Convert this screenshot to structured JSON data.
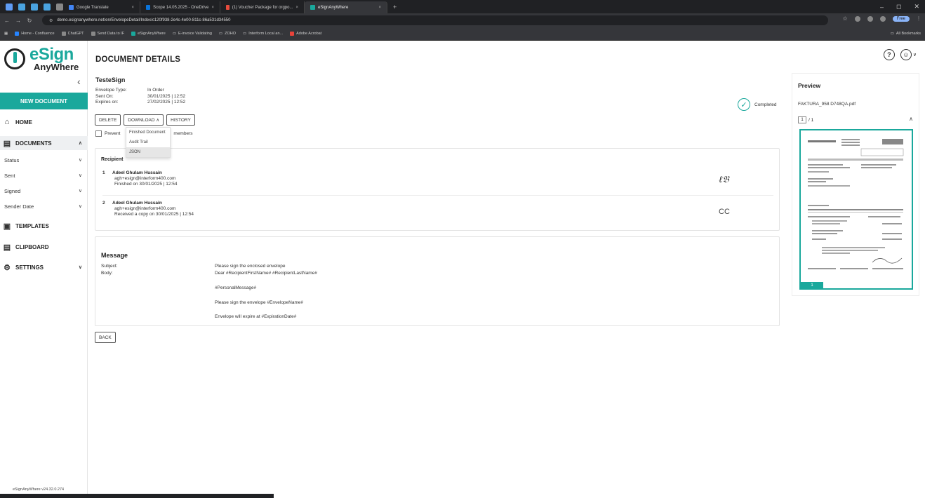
{
  "browser": {
    "tabs": [
      {
        "label": "Google Translate",
        "color": "#4285f4",
        "active": false
      },
      {
        "label": "Scope 14.05.2025 - OneDrive",
        "color": "#0a74da",
        "active": false
      },
      {
        "label": "(1) Voucher Package for orgpo...",
        "color": "#e84c3d",
        "active": false
      },
      {
        "label": "eSignAnyWhere",
        "color": "#1aa89c",
        "active": true
      }
    ],
    "url": "demo.esignanywhere.net/en/EnvelopeDetail/Index/c120f938-2e4c-4e00-811c-86a531d34550",
    "free_label": "Free",
    "bookmarks": [
      "Home - Confluence",
      "ChatGPT",
      "Send Data to IF",
      "eSignAnyWhere",
      "E-invoice Validating",
      "ZOHO",
      "Interform Local an...",
      "Adobe Acrobat"
    ],
    "all_bookmarks": "All Bookmarks"
  },
  "logo": {
    "line1": "eSign",
    "line2": "AnyWhere"
  },
  "sidebar": {
    "new_document": "NEW DOCUMENT",
    "home": "HOME",
    "documents": "DOCUMENTS",
    "sub_items": [
      "Status",
      "Sent",
      "Signed",
      "Sender Date"
    ],
    "templates": "TEMPLATES",
    "clipboard": "CLIPBOARD",
    "settings": "SETTINGS",
    "version": "eSignAnyWhere v24.32.0.274"
  },
  "page": {
    "title": "DOCUMENT DETAILS"
  },
  "envelope": {
    "name": "TesteSign",
    "meta": [
      {
        "k": "Envelope Type:",
        "v": "In Order"
      },
      {
        "k": "Sent On:",
        "v": "30/01/2025 | 12:52"
      },
      {
        "k": "Expires on:",
        "v": "27/02/2025 | 12:52"
      }
    ],
    "status": "Completed"
  },
  "actions": {
    "delete": "DELETE",
    "download": "DOWNLOAD",
    "history": "HISTORY"
  },
  "prevent": {
    "label_start": "Prevent",
    "label_end": "members"
  },
  "dropdown": {
    "finished": "Finished Document",
    "audit": "Audit Trail",
    "json": "JSON"
  },
  "recipients": {
    "heading": "Recipient",
    "items": [
      {
        "num": "1",
        "name": "Adeel Ghulam Hussain",
        "email": "agh+esign@interform400.com",
        "status": "Finished on 30/01/2025 | 12:54"
      },
      {
        "num": "2",
        "name": "Adeel Ghulam Hussain",
        "email": "agh+esign@interform400.com",
        "status": "Received a copy on 30/01/2025 | 12:54"
      }
    ],
    "cc_label": "CC"
  },
  "message": {
    "title": "Message",
    "subject_label": "Subject:",
    "body_label": "Body:",
    "subject": "Please sign the enclosed envelope",
    "body_lines": [
      "Dear #RecipientFirstName# #RecipientLastName#",
      "#PersonalMessage#",
      "Please sign the envelope #EnvelopeName#",
      "Envelope will expire at #ExpirationDate#"
    ]
  },
  "back": "BACK",
  "preview": {
    "title": "Preview",
    "file": "FAKTURA_958 D748QA.pdf",
    "page": "1",
    "pages": "/ 1",
    "thumb_page": "1"
  }
}
